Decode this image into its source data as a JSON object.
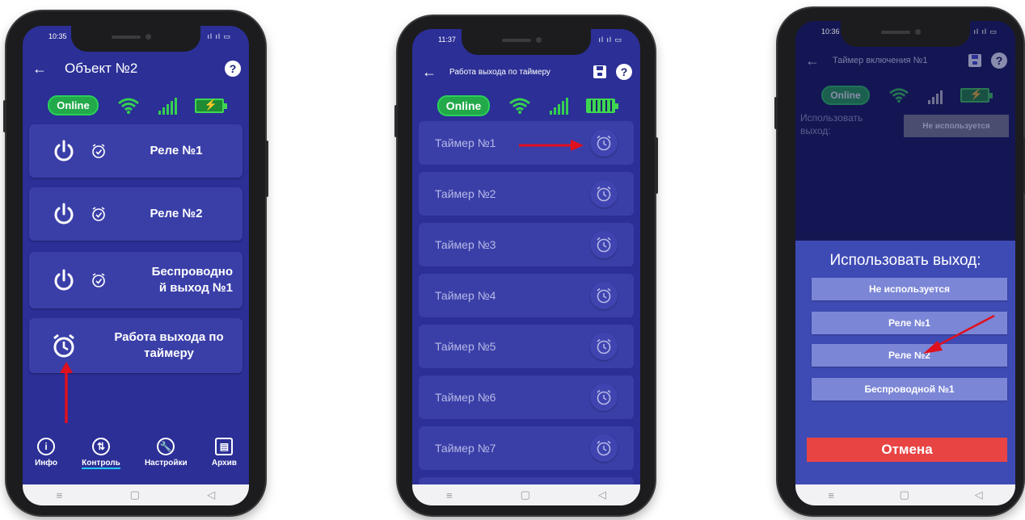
{
  "phone1": {
    "time": "10:35",
    "indicators": "ıl ıl ▭",
    "title": "Объект №2",
    "online": "Online",
    "cards": [
      {
        "label": "Реле №1"
      },
      {
        "label": "Реле №2"
      },
      {
        "label_line1": "Беспроводно",
        "label_line2": "й выход №1"
      },
      {
        "label_line1": "Работа выхода по",
        "label_line2": "таймеру"
      }
    ],
    "nav": [
      {
        "label": "Инфо",
        "glyph": "i"
      },
      {
        "label": "Контроль",
        "glyph": "⇅"
      },
      {
        "label": "Настройки",
        "glyph": "🔧"
      },
      {
        "label": "Архив",
        "glyph": "▤"
      }
    ]
  },
  "phone2": {
    "time": "11:37",
    "indicators": "ıl ıl ▭",
    "title": "Работа выхода по таймеру",
    "online": "Online",
    "timers": [
      "Таймер №1",
      "Таймер №2",
      "Таймер №3",
      "Таймер №4",
      "Таймер №5",
      "Таймер №6",
      "Таймер №7"
    ]
  },
  "phone3": {
    "time": "10:36",
    "indicators": "ıl ıl ▭",
    "title": "Таймер включения №1",
    "online": "Online",
    "use_output_label": "Использовать выход:",
    "current_value": "Не используется",
    "sheet_title": "Использовать выход:",
    "options": [
      "Не используется",
      "Реле №1",
      "Реле №2",
      "Беспроводной №1"
    ],
    "cancel": "Отмена"
  },
  "system_nav": {
    "menu": "≡",
    "home": "▢",
    "back": "◁"
  },
  "colors": {
    "screen_bg": "#2b2f96",
    "card_bg": "#3a3fa8",
    "online_green": "#22a94a",
    "cancel_red": "#e84444",
    "arrow_red": "#e0101e"
  }
}
